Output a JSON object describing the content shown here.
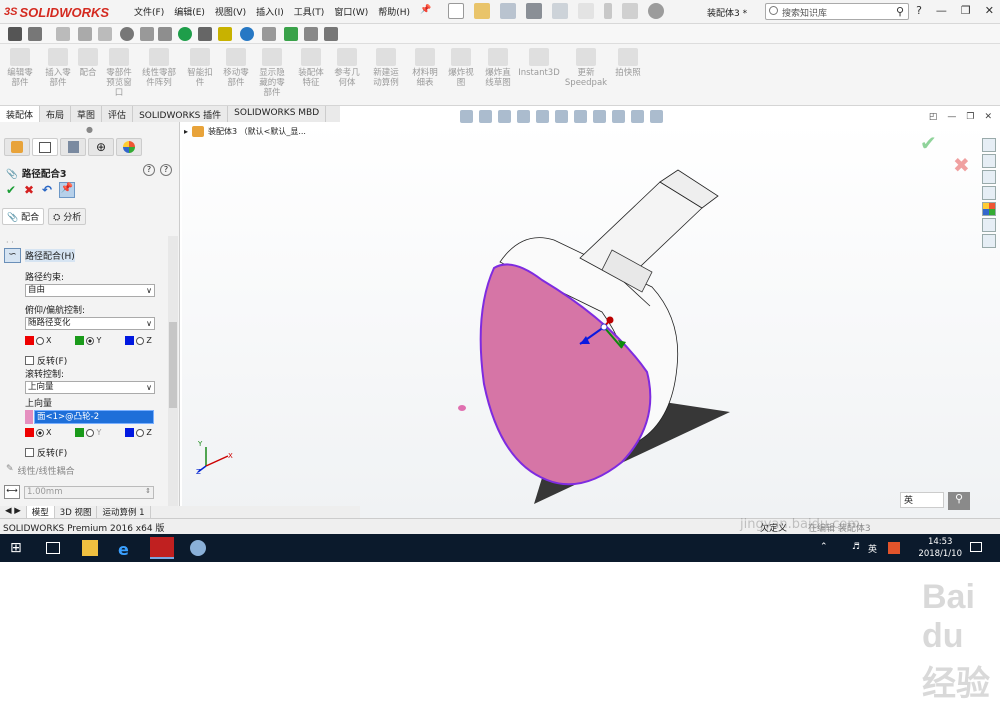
{
  "app": {
    "logo_ds": "3S",
    "logo_text": "SOLIDWORKS"
  },
  "menu": [
    "文件(F)",
    "编辑(E)",
    "视图(V)",
    "插入(I)",
    "工具(T)",
    "窗口(W)",
    "帮助(H)"
  ],
  "document_title": "装配体3 *",
  "search": {
    "placeholder": "搜索知识库"
  },
  "ribbon": [
    {
      "label": "编辑零\n部件"
    },
    {
      "label": "插入零\n部件"
    },
    {
      "label": "配合"
    },
    {
      "label": "零部件\n预览窗\n口"
    },
    {
      "label": "线性零部\n件阵列"
    },
    {
      "label": "智能扣\n件"
    },
    {
      "label": "移动零\n部件"
    },
    {
      "label": "显示隐\n藏的零\n部件"
    },
    {
      "label": "装配体\n特征"
    },
    {
      "label": "参考几\n何体"
    },
    {
      "label": "新建运\n动算例"
    },
    {
      "label": "材料明\n细表"
    },
    {
      "label": "爆炸视\n图"
    },
    {
      "label": "爆炸直\n线草图"
    },
    {
      "label": "Instant3D"
    },
    {
      "label": "更新\nSpeedpak"
    },
    {
      "label": "拍快照"
    }
  ],
  "command_tabs": [
    "装配体",
    "布局",
    "草图",
    "评估",
    "SOLIDWORKS 插件",
    "SOLIDWORKS MBD"
  ],
  "tree": {
    "root": "装配体3 （默认<默认_显..."
  },
  "property_manager": {
    "title": "路径配合3",
    "subtabs": [
      "配合",
      "分析"
    ],
    "mate_type": "路径配合(H)",
    "path_constraint_label": "路径约束:",
    "path_constraint_value": "自由",
    "pitch_yaw_label": "俯仰/偏航控制:",
    "pitch_yaw_value": "随路径变化",
    "axis_x": "X",
    "axis_y": "Y",
    "axis_z": "Z",
    "flip1": "反转(F)",
    "roll_label": "滚转控制:",
    "roll_value": "上向量",
    "up_vector_label": "上向量",
    "up_vector_value": "面<1>@凸轮-2",
    "flip2": "反转(F)",
    "linear_coupling": "线性/线性耦合",
    "distance": "1.00mm"
  },
  "bottom_tabs": [
    "模型",
    "3D 视图",
    "运动算例 1"
  ],
  "status_bar": {
    "left": "SOLIDWORKS Premium 2016 x64 版",
    "middle": "欠定义",
    "right": "在编辑 装配体3"
  },
  "taskbar": {
    "ime": "英",
    "time": "14:53",
    "date": "2018/1/10"
  },
  "watermark": {
    "brand": "Bai du 经验",
    "url": "jingyan.baidu.com"
  },
  "colors": {
    "face_pink": "#d675a6",
    "outline": "#8a2be2",
    "accent": "#1e6fd9",
    "taskbar": "#0b1a2c"
  }
}
